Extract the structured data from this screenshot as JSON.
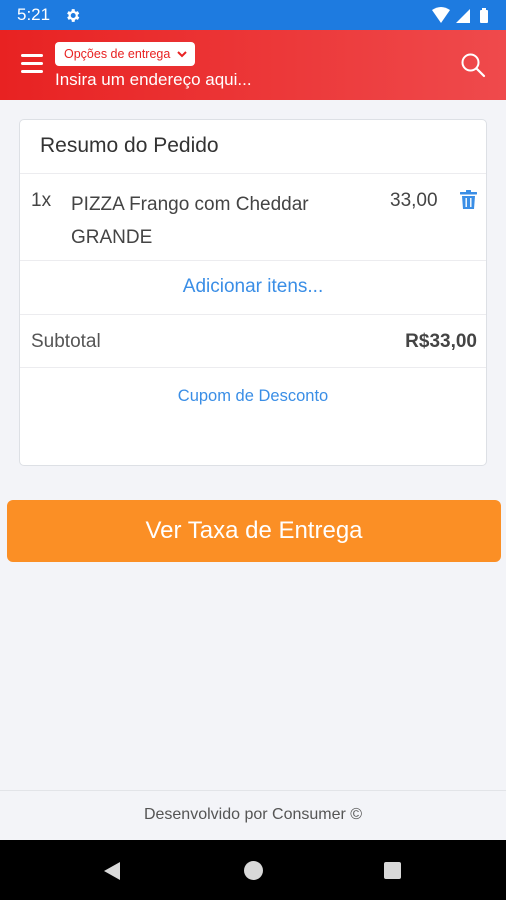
{
  "status_bar": {
    "time": "5:21",
    "icons": [
      "settings-icon",
      "wifi-icon",
      "signal-icon",
      "battery-icon"
    ]
  },
  "header": {
    "delivery_options_label": "Opções de entrega",
    "address_placeholder": "Insira um endereço aqui...",
    "icons": [
      "menu-icon",
      "chevron-down-icon",
      "search-icon"
    ],
    "gradient_colors": [
      "#e82222",
      "#ef4a4c"
    ]
  },
  "order_summary": {
    "title": "Resumo do Pedido",
    "items": [
      {
        "quantity": "1x",
        "name": "PIZZA Frango com Cheddar GRANDE",
        "price": "33,00"
      }
    ],
    "add_items_label": "Adicionar itens...",
    "subtotal_label": "Subtotal",
    "subtotal_value": "R$33,00",
    "coupon_label": "Cupom de Desconto"
  },
  "actions": {
    "delivery_fee_button": "Ver Taxa de Entrega"
  },
  "footer": {
    "credit": "Desenvolvido por Consumer ©"
  },
  "colors": {
    "status_bar": "#1e7be0",
    "accent_orange": "#fb8f25",
    "link_blue": "#3a8ee6",
    "brand_red": "#e82222"
  }
}
